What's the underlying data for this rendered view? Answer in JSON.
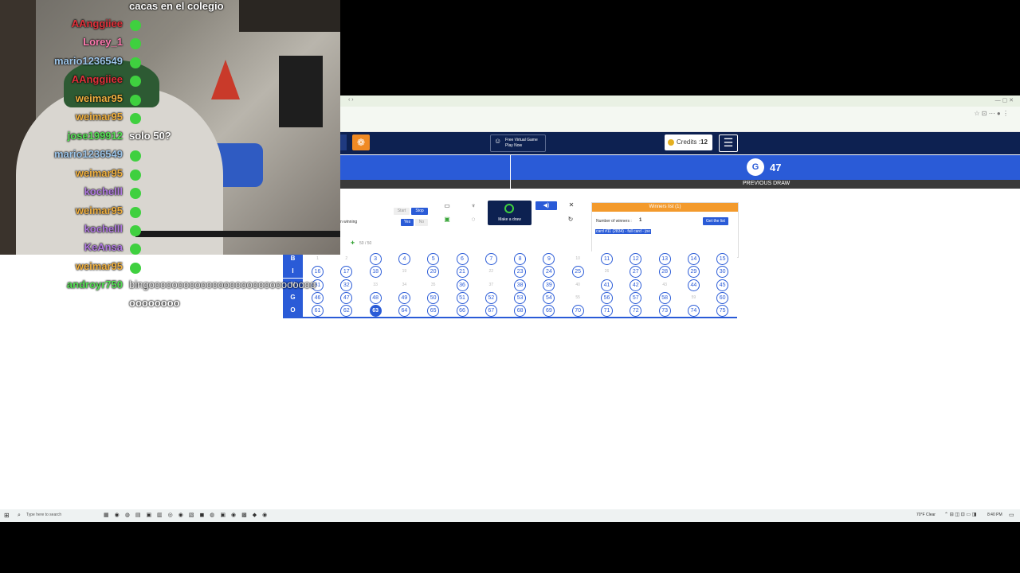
{
  "browser": {
    "tab_text": "— ▢ ✕"
  },
  "navbar": {
    "promo_label": "Free Virtual Game Play Now",
    "credits_label": "Credits :",
    "credits_value": "12",
    "menu_icon": "hamburger-icon"
  },
  "draw": {
    "letter": "G",
    "number": "47",
    "previous_label": "PREVIOUS DRAW"
  },
  "controls": {
    "winning_label": "n winning",
    "stop_label": "Stop",
    "start_label": "Start",
    "yes_label": "Yes",
    "no_label": "No",
    "make_draw_label": "Make a draw",
    "players_count": "50 / 50"
  },
  "winners": {
    "header": "Winners list (1)",
    "count_label": "Number of winners :",
    "count_value": "1",
    "get_list_label": "Get the list",
    "entry": "card #11 (2834) - full card - joe"
  },
  "board": {
    "rows": [
      {
        "letter": "B",
        "start": 1
      },
      {
        "letter": "I",
        "start": 16
      },
      {
        "letter": "N",
        "start": 31
      },
      {
        "letter": "G",
        "start": 46
      },
      {
        "letter": "O",
        "start": 61
      }
    ],
    "called": [
      3,
      4,
      5,
      6,
      7,
      8,
      9,
      11,
      12,
      13,
      14,
      15,
      16,
      17,
      18,
      20,
      21,
      23,
      24,
      25,
      27,
      28,
      29,
      30,
      31,
      32,
      36,
      38,
      39,
      41,
      42,
      44,
      45,
      46,
      47,
      48,
      49,
      50,
      51,
      52,
      53,
      54,
      56,
      57,
      58,
      60,
      61,
      62,
      63,
      64,
      65,
      66,
      67,
      68,
      69,
      70,
      71,
      72,
      73,
      74,
      75
    ],
    "current": 63
  },
  "chat": [
    {
      "name": "",
      "message": "cacas en el colegio",
      "color": "#ffffff"
    },
    {
      "name": "AAnggiiee",
      "message": "",
      "color": "#e0303a"
    },
    {
      "name": "Lorey_1",
      "message": "",
      "color": "#ff7ab0"
    },
    {
      "name": "mario1236549",
      "message": "",
      "color": "#9cc4e8"
    },
    {
      "name": "AAnggiiee",
      "message": "",
      "color": "#e0303a"
    },
    {
      "name": "weimar95",
      "message": "",
      "color": "#f0b040"
    },
    {
      "name": "weimar95",
      "message": "",
      "color": "#f0b040"
    },
    {
      "name": "jose199912",
      "message": "solo 50?",
      "color": "#55e055"
    },
    {
      "name": "mario1236549",
      "message": "",
      "color": "#9cc4e8"
    },
    {
      "name": "weimar95",
      "message": "",
      "color": "#f0b040"
    },
    {
      "name": "kochelll",
      "message": "",
      "color": "#b07ae0"
    },
    {
      "name": "weimar95",
      "message": "",
      "color": "#f0b040"
    },
    {
      "name": "kochelll",
      "message": "",
      "color": "#b07ae0"
    },
    {
      "name": "KeAnsa",
      "message": "",
      "color": "#b07ae0"
    },
    {
      "name": "weimar95",
      "message": "",
      "color": "#f0b040"
    },
    {
      "name": "androyr750",
      "message": "bingooooooooooooooooooooooooooooo",
      "color": "#55e055"
    },
    {
      "name": "",
      "message": "oooooooo",
      "color": "#ffffff"
    }
  ],
  "taskbar": {
    "search_placeholder": "Type here to search",
    "weather": "70°F Clear",
    "time": "8:40 PM"
  }
}
